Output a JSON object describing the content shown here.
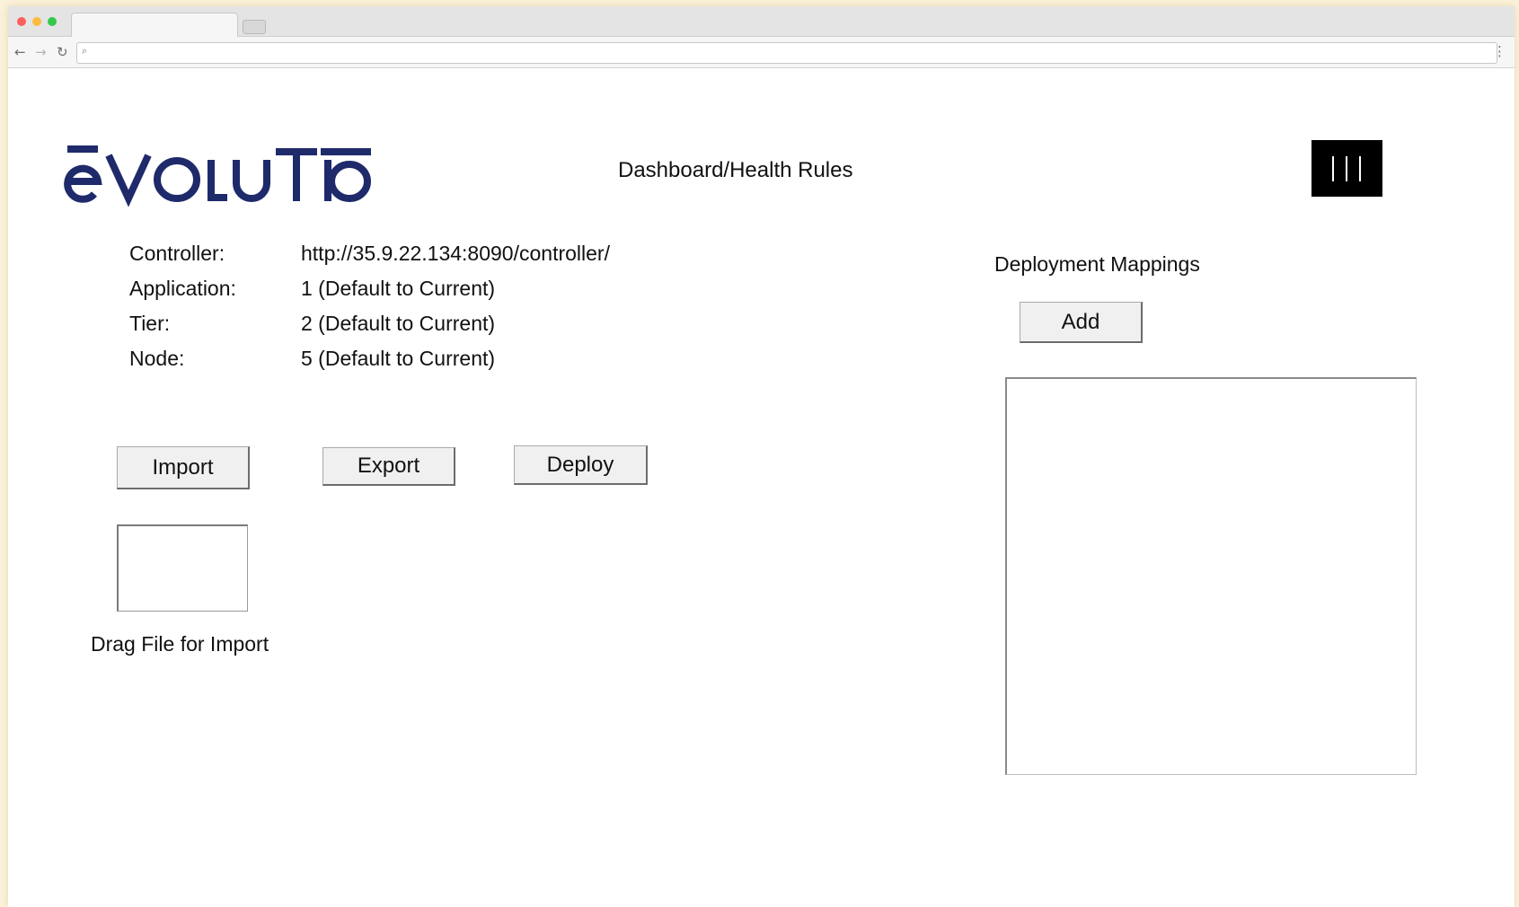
{
  "browser": {
    "address_value": "",
    "icons": {
      "back": "arrow-left-icon",
      "forward": "arrow-right-icon",
      "reload": "reload-icon",
      "search": "search-icon",
      "menu": "kebab-menu-icon"
    }
  },
  "header": {
    "logo_text": "ēVOLUTIO",
    "title": "Dashboard/Health Rules",
    "menu_icon": "hamburger-menu-icon",
    "brand_color": "#1f2a6b"
  },
  "info": {
    "controller_label": "Controller:",
    "controller_value": "http://35.9.22.134:8090/controller/",
    "application_label": "Application:",
    "application_value": "1 (Default to Current)",
    "tier_label": "Tier:",
    "tier_value": "2 (Default to Current)",
    "node_label": "Node:",
    "node_value": "5 (Default to Current)"
  },
  "actions": {
    "import_label": "Import",
    "export_label": "Export",
    "deploy_label": "Deploy"
  },
  "dropzone": {
    "label": "Drag File for Import"
  },
  "deployment": {
    "title": "Deployment Mappings",
    "add_label": "Add"
  }
}
